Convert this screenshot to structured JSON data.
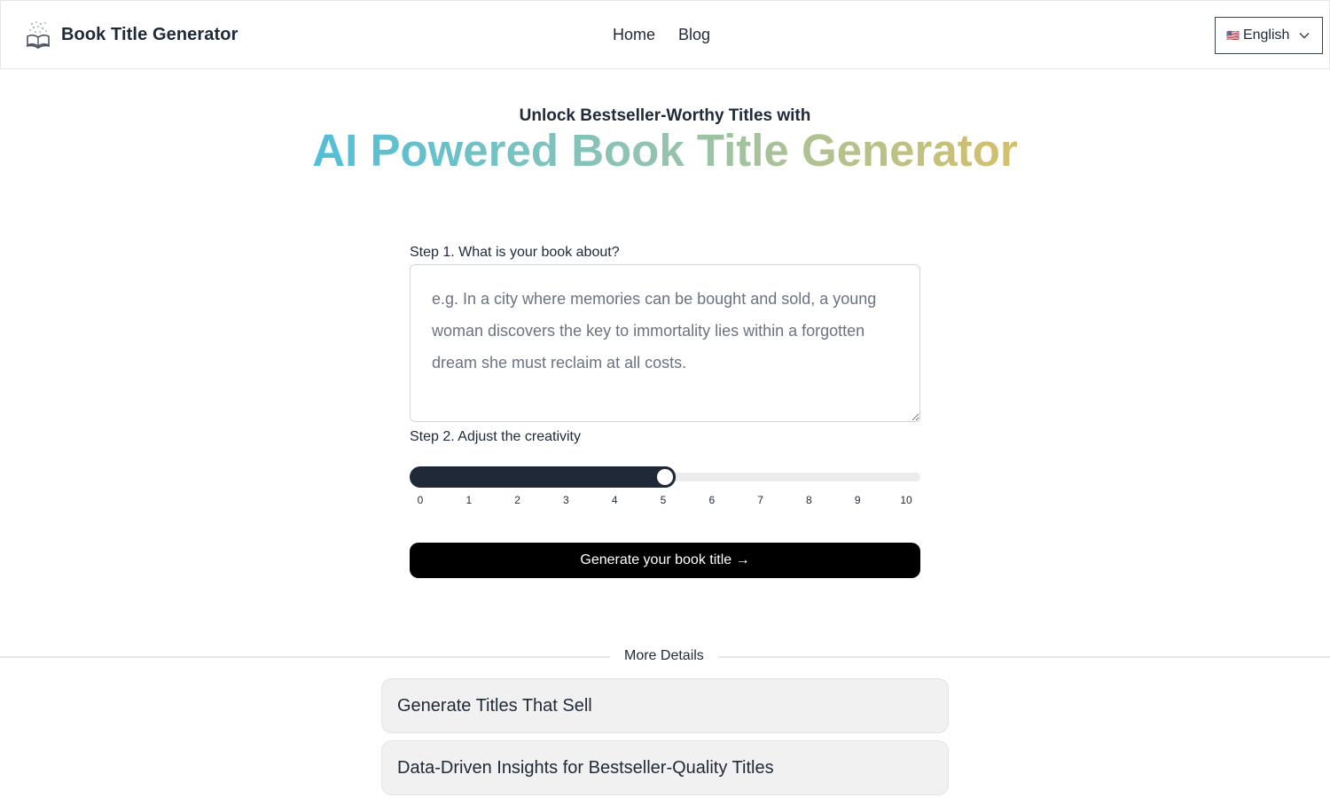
{
  "header": {
    "brand_name": "Book Title Generator",
    "logo_icon": "open-book-icon",
    "nav": [
      {
        "label": "Home"
      },
      {
        "label": "Blog"
      }
    ],
    "language": {
      "flag": "🇺🇸",
      "selected": "English"
    }
  },
  "hero": {
    "subtitle": "Unlock Bestseller-Worthy Titles with",
    "title": "AI Powered Book Title Generator",
    "gradient_colors": [
      "#4fbfd9",
      "#8ec3b4",
      "#d4c06a"
    ]
  },
  "form": {
    "step1_label": "Step 1. What is your book about?",
    "description_value": "",
    "description_placeholder": "e.g. In a city where memories can be bought and sold, a young woman discovers the key to immortality lies within a forgotten dream she must reclaim at all costs.",
    "step2_label": "Step 2. Adjust the creativity",
    "creativity": {
      "min": 0,
      "max": 10,
      "value": 5,
      "ticks": [
        "0",
        "1",
        "2",
        "3",
        "4",
        "5",
        "6",
        "7",
        "8",
        "9",
        "10"
      ]
    },
    "generate_label": "Generate your book title →"
  },
  "details": {
    "divider_label": "More Details",
    "items": [
      {
        "title": "Generate Titles That Sell"
      },
      {
        "title": "Data-Driven Insights for Bestseller-Quality Titles"
      }
    ]
  }
}
